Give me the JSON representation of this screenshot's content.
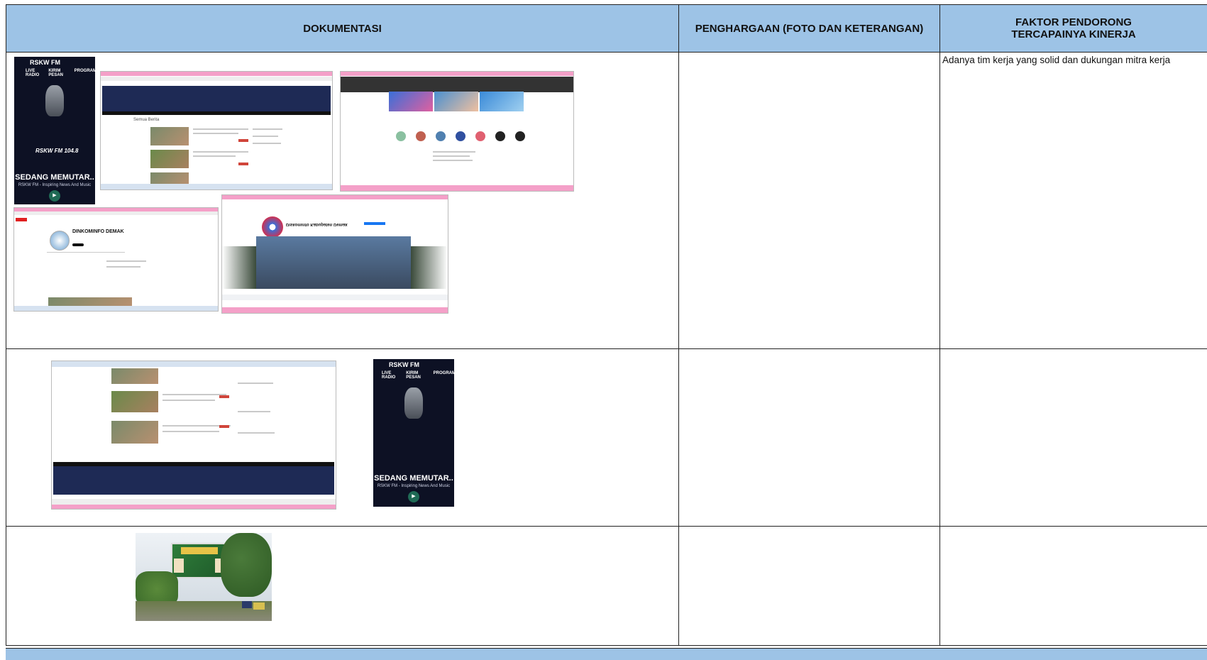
{
  "headers": {
    "dokumentasi": "DOKUMENTASI",
    "penghargaan": "PENGHARGAAN (FOTO DAN KETERANGAN)",
    "faktor_line1": "FAKTOR PENDORONG",
    "faktor_line2": "TERCAPAINYA KINERJA"
  },
  "rows": [
    {
      "faktor_text": "Adanya tim kerja yang solid dan dukungan mitra kerja",
      "radio": {
        "app_title": "RSKW FM",
        "nav": [
          "LIVE RADIO",
          "KIRIM PESAN",
          "PROGRAM"
        ],
        "now_playing": "SEDANG MEMUTAR..",
        "tagline": "RSKW FM - Inspiring News And Music",
        "logo_text": "RSKW FM 104.8"
      },
      "website": {
        "section_title": "Semua Berita"
      },
      "youtube": {
        "channel_name": "DINKOMINFO DEMAK"
      },
      "facebook": {
        "page_name": "Diskominfo Kabupaten Demak"
      }
    },
    {
      "faktor_text": "",
      "radio": {
        "app_title": "RSKW FM",
        "nav": [
          "LIVE RADIO",
          "KIRIM PESAN",
          "PROGRAM"
        ],
        "now_playing": "SEDANG MEMUTAR..",
        "tagline": "RSKW FM - Inspiring News And Music"
      }
    },
    {
      "faktor_text": ""
    }
  ],
  "colors": {
    "header_bg": "#9dc3e6",
    "radio_bg": "#0d1124",
    "web_navy": "#1e2a55",
    "browser_bar": "#f4a0c8"
  }
}
